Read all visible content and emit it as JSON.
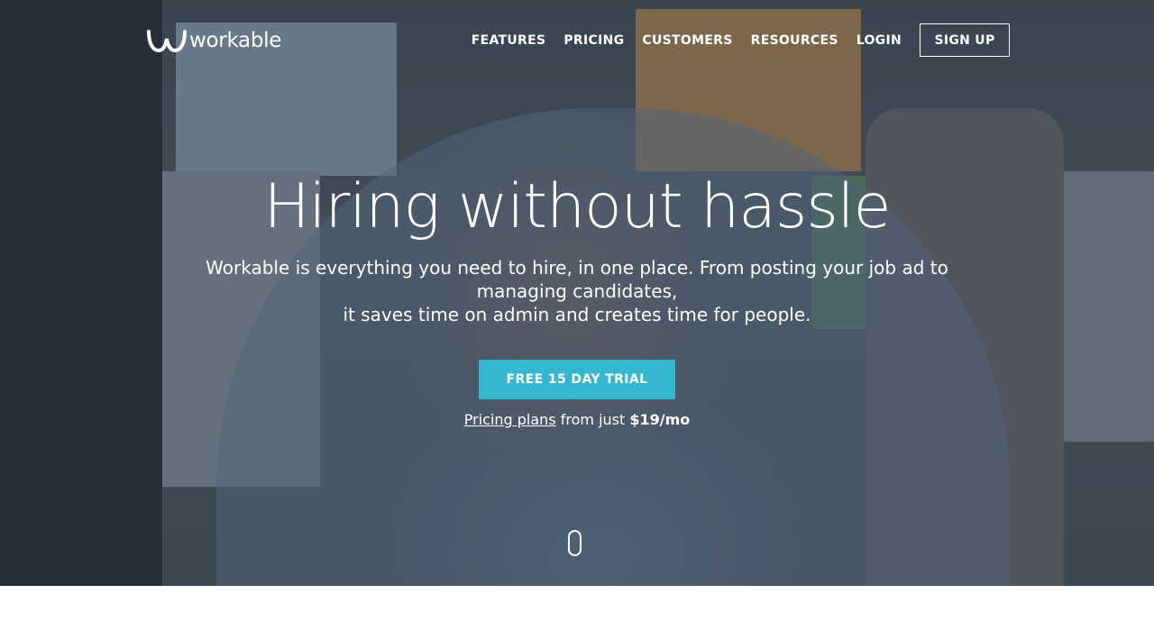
{
  "brand": {
    "name": "workable",
    "logo_icon": "workable-logo-icon"
  },
  "nav": {
    "items": [
      {
        "label": "FEATURES"
      },
      {
        "label": "PRICING"
      },
      {
        "label": "CUSTOMERS"
      },
      {
        "label": "RESOURCES"
      },
      {
        "label": "LOGIN"
      }
    ],
    "signup_label": "SIGN UP"
  },
  "hero": {
    "headline": "Hiring without hassle",
    "subtext_line1": "Workable is everything you need to hire, in one place. From posting your job ad to managing candidates,",
    "subtext_line2": "it saves time on admin and creates time for people.",
    "cta_label": "FREE 15 DAY TRIAL",
    "pricing_link": "Pricing plans",
    "pricing_mid": " from just ",
    "pricing_price": "$19/mo",
    "scroll_icon": "scroll-mouse-icon"
  },
  "colors": {
    "accent": "#34b7cf",
    "text": "#ffffff"
  }
}
